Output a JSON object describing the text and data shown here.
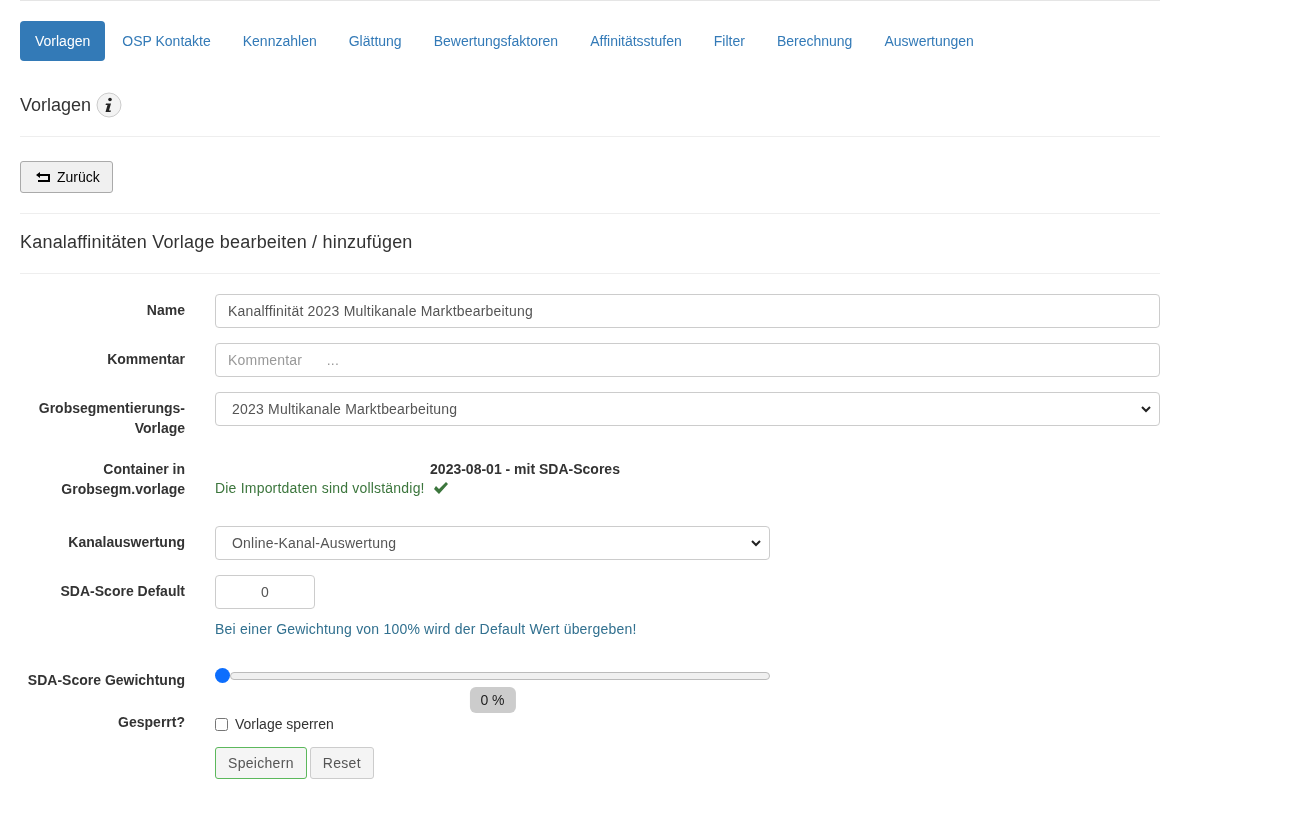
{
  "tabs": [
    {
      "label": "Vorlagen",
      "selected": true
    },
    {
      "label": "OSP Kontakte",
      "selected": false
    },
    {
      "label": "Kennzahlen",
      "selected": false
    },
    {
      "label": "Glättung",
      "selected": false
    },
    {
      "label": "Bewertungsfaktoren",
      "selected": false
    },
    {
      "label": "Affinitätsstufen",
      "selected": false
    },
    {
      "label": "Filter",
      "selected": false
    },
    {
      "label": "Berechnung",
      "selected": false
    },
    {
      "label": "Auswertungen",
      "selected": false
    }
  ],
  "page_title": "Vorlagen",
  "back_button": "Zurück",
  "section_title": "Kanalaffinitäten Vorlage bearbeiten / hinzufügen",
  "form": {
    "rows": [
      {
        "kind": "text",
        "label": "Name",
        "value": "Kanalffinität 2023 Multikanale Marktbearbeitung"
      },
      {
        "kind": "text",
        "label": "Kommentar",
        "placeholder": "Kommentar      ..."
      },
      {
        "kind": "select",
        "label": "Grobsegmentierungs-Vorlage",
        "value": "2023 Multikanale Marktbearbeitung"
      },
      {
        "kind": "info",
        "label": "Container in Grobsegm.vorlage",
        "heading": "2023-08-01 - mit SDA-Scores",
        "status": "Die Importdaten sind vollständig!"
      },
      {
        "kind": "select",
        "label": "Kanalauswertung",
        "value": "Online-Kanal-Auswertung"
      },
      {
        "kind": "number",
        "label": "SDA-Score Default",
        "value": "0",
        "hint": "Bei einer Gewichtung von 100% wird der Default Wert übergeben!"
      },
      {
        "kind": "slider",
        "label": "SDA-Score Gewichtung",
        "level": 0,
        "reading": "0 %"
      },
      {
        "kind": "checkbox",
        "label": "Gesperrt?",
        "text": "Vorlage sperren",
        "checked": false
      }
    ]
  },
  "buttons": [
    {
      "label": "Speichern",
      "kind": "success"
    },
    {
      "label": "Reset",
      "kind": "default"
    }
  ]
}
